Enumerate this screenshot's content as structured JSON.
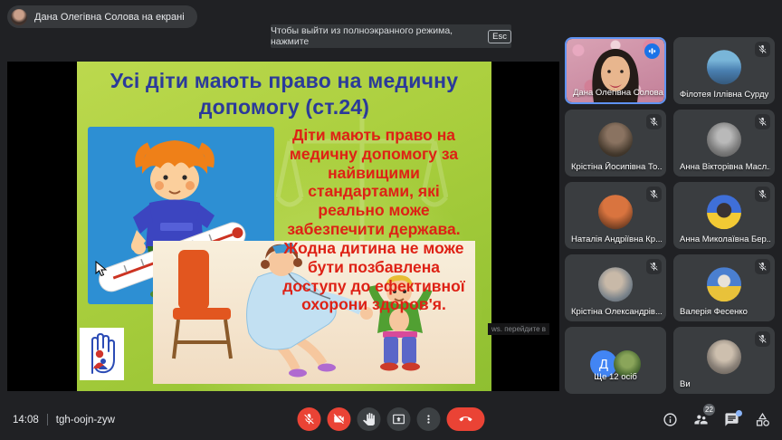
{
  "banner": {
    "label": "Дана Олегівна Солова на екрані"
  },
  "toast": {
    "text": "Чтобы выйти из полноэкранного режима, нажмите",
    "key": "Esc"
  },
  "slide": {
    "title_lines": [
      "Усі діти мають право на медичну",
      "допомогу (ст.24)"
    ],
    "body_lines": [
      "Діти мають право на",
      "медичну допомогу за",
      "найвищими",
      "стандартами, які",
      "реально може",
      "забезпечити держава.",
      "Жодна дитина не може",
      "бути позбавлена",
      "доступу до ефективної",
      "охорони здоров'я."
    ],
    "overlay_hint": "ws. перейдите в"
  },
  "participants": [
    {
      "name": "Дана Олегівна Солова",
      "status": "speaking"
    },
    {
      "name": "Філотея Іллівна Сурду",
      "status": "muted"
    },
    {
      "name": "Крістіна Йосипівна То...",
      "status": "muted"
    },
    {
      "name": "Анна Вікторівна Масл...",
      "status": "muted"
    },
    {
      "name": "Наталія Андріївна Кр...",
      "status": "muted"
    },
    {
      "name": "Анна Миколаївна Бер...",
      "status": "muted"
    },
    {
      "name": "Крістіна Олександрів...",
      "status": "muted"
    },
    {
      "name": "Валерія Фесенко",
      "status": "muted"
    },
    {
      "name": "Ще 12 осіб",
      "status": "overflow",
      "initial": "Д"
    },
    {
      "name": "Ви",
      "status": "muted"
    }
  ],
  "bottom_bar": {
    "time": "14:08",
    "meeting_code": "tgh-oojn-zyw",
    "people_badge": "22",
    "controls": [
      "mic-off",
      "camera-off",
      "raise-hand",
      "present",
      "more-options",
      "end-call"
    ],
    "right_icons": [
      "info",
      "people",
      "chat",
      "activities"
    ]
  },
  "colors": {
    "control_red": "#ea4335",
    "control_dark": "#3c4043",
    "active_speaker_border": "#5f93f2",
    "speaking_indicator": "#1a73e8",
    "slide_title_blue": "#2b3a9a",
    "slide_text_red": "#de2115",
    "chat_notification_dot": "#8ab4f8"
  }
}
